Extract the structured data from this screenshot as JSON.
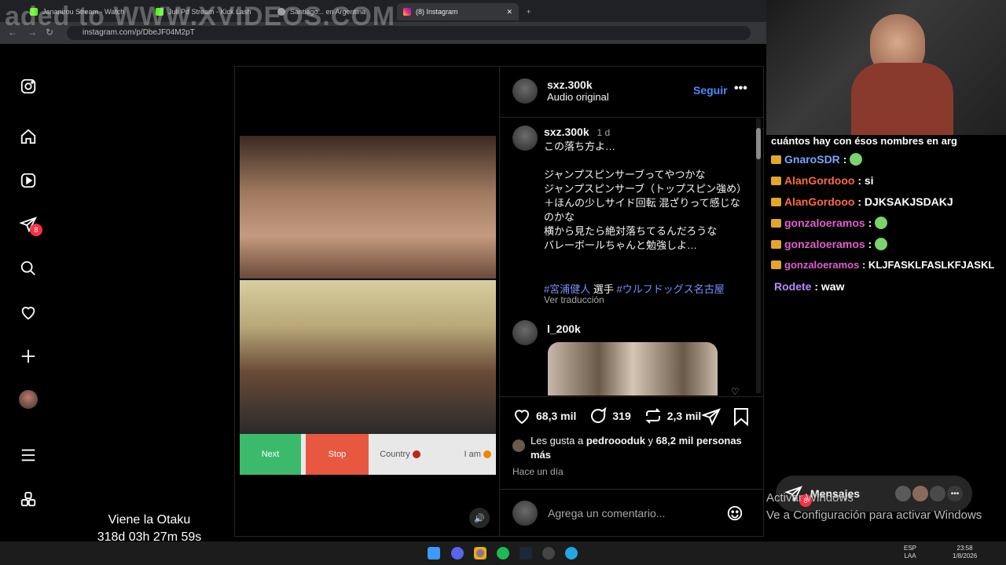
{
  "browser": {
    "tabs": [
      {
        "label": "Jananirou Stream - Watch"
      },
      {
        "label": "Juli Pd Stream - Kick Lash"
      },
      {
        "label": "Santiago... en Argentina"
      },
      {
        "label": "(8) Instagram"
      }
    ],
    "url": "instagram.com/p/DbeJF04M2pT",
    "watermark": "aded to WWW.XVIDEOS.COM"
  },
  "instagram": {
    "nav_badge": "8",
    "post": {
      "author": "sxz.300k",
      "audio": "Audio original",
      "follow_label": "Seguir",
      "caption_author": "sxz.300k",
      "caption_time": "1 d",
      "caption_lines": [
        "この落ち方よ…",
        "",
        "ジャンプスピンサーブってやつかな",
        "ジャンプスピンサーブ（トップスピン強め）＋ほんの少しサイド回転 混ざりって感じなのかな",
        "横から見たら絶対落ちてるんだろうな",
        "バレーボールちゃんと勉強しよ…"
      ],
      "hashtag_1": "#宮浦健人",
      "hashtag_mid": " 選手 ",
      "hashtag_2": "#ウルフドッグス名古屋",
      "translate_label": "Ver traducción",
      "comment_author": "l_200k",
      "likes": "68,3 mil",
      "comments": "319",
      "shares": "2,3 mil",
      "liked_by_prefix": "Les gusta a ",
      "liked_by_user": "pedroooduk",
      "liked_by_mid": " y ",
      "liked_by_count": "68,2 mil personas más",
      "time_ago": "Hace un día",
      "comment_placeholder": "Agrega un comentario..."
    },
    "video_buttons": {
      "next": "Next",
      "stop": "Stop",
      "country": "Country",
      "iam": "I am"
    },
    "messages_label": "Mensajes",
    "messages_badge": "8"
  },
  "stream": {
    "overlay_title": "Viene la Otaku",
    "overlay_timer": "318d 03h 27m 59s",
    "chat_header": "cuántos hay con ésos nombres en arg",
    "chat": [
      {
        "user": "GnaroSDR",
        "color": "#7aa6ff",
        "text": ":"
      },
      {
        "user": "AlanGordooo",
        "color": "#ff6a3d",
        "text": ": si"
      },
      {
        "user": "AlanGordooo",
        "color": "#ff6a3d",
        "text": ": DJKSAKJSDAKJ"
      },
      {
        "user": "gonzaloeramos",
        "color": "#e15fd0",
        "text": ":"
      },
      {
        "user": "gonzaloeramos",
        "color": "#e15fd0",
        "text": ":"
      },
      {
        "user": "gonzaloeramos",
        "color": "#e15fd0",
        "text": ": KLJFASKLFASLKFJASKL"
      },
      {
        "user": "Rodete",
        "color": "#b38cff",
        "text": ": waw"
      }
    ]
  },
  "windows": {
    "activate_title": "Activar Windows",
    "activate_sub": "Ve a Configuración para activar Windows",
    "lang": "ESP",
    "lang2": "LAA",
    "time": "23:58",
    "date": "1/8/2026"
  }
}
